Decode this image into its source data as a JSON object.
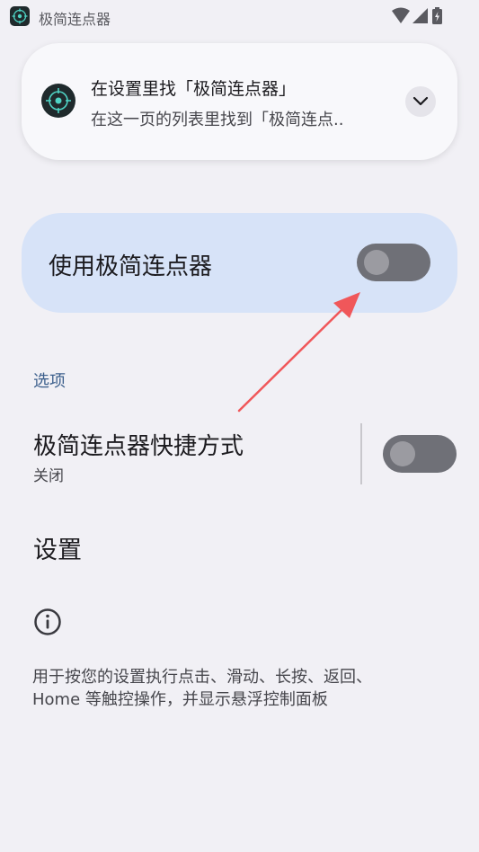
{
  "status_bar": {
    "app_name": "极简连点器",
    "icons": [
      "wifi-icon",
      "cellular-signal-icon",
      "battery-charging-icon"
    ]
  },
  "notification": {
    "title": "在设置里找「极简连点器」",
    "body": "在这一页的列表里找到「极简连点..",
    "expand_icon": "chevron-down-icon"
  },
  "main_toggle": {
    "label": "使用极简连点器",
    "on": false
  },
  "options": {
    "header": "选项",
    "shortcut": {
      "title": "极简连点器快捷方式",
      "state_text": "关闭",
      "on": false
    },
    "settings_label": "设置"
  },
  "description": {
    "line1": "用于按您的设置执行点击、滑动、长按、返回、",
    "line2": "Home 等触控操作，并显示悬浮控制面板"
  },
  "colors": {
    "background": "#f1f0f5",
    "card_highlight": "#d7e3f8",
    "switch_off_track": "#6f7077",
    "section_header": "#3c5f8c",
    "annotation_arrow": "#f0575a"
  }
}
